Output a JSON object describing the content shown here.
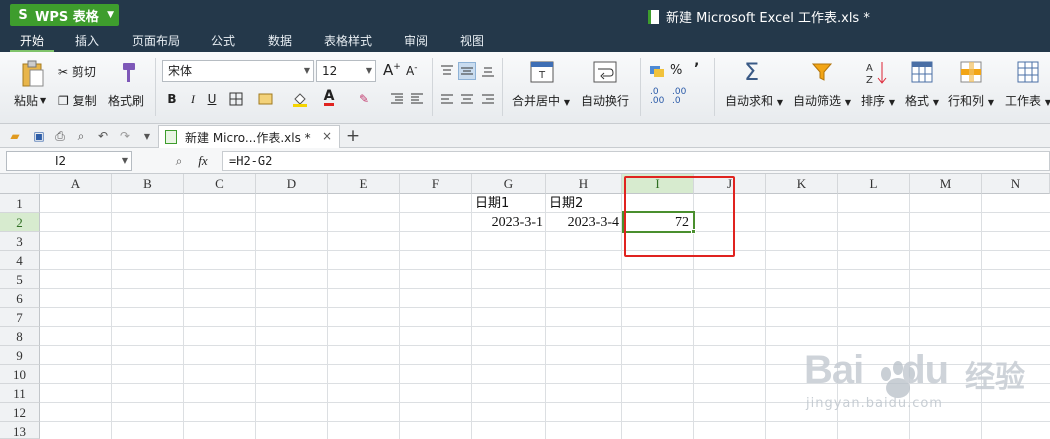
{
  "app": {
    "name": "WPS 表格",
    "logo_letter": "S",
    "window_title": "新建 Microsoft Excel 工作表.xls *"
  },
  "menu": {
    "tabs": [
      "开始",
      "插入",
      "页面布局",
      "公式",
      "数据",
      "表格样式",
      "审阅",
      "视图"
    ],
    "active": "开始"
  },
  "ribbon": {
    "paste": "粘贴",
    "cut": "剪切",
    "copy": "复制",
    "format_painter": "格式刷",
    "font_name": "宋体",
    "font_size": "12",
    "bold": "B",
    "italic": "I",
    "underline": "U",
    "increase_font": "A",
    "decrease_font": "A",
    "merge_center": "合并居中",
    "wrap_text": "自动换行",
    "percent": "%",
    "comma": "’",
    "autosum": "自动求和",
    "autofilter": "自动筛选",
    "sort": "排序",
    "format": "格式",
    "row_col": "行和列",
    "worksheet": "工作表",
    "inc_decimal": ".0\n.00",
    "dec_decimal": ".00\n.0"
  },
  "doc_tab": {
    "label": "新建 Micro...作表.xls *",
    "close": "×",
    "add": "+"
  },
  "formula_bar": {
    "name_box": "I2",
    "fx": "fx",
    "formula": "=H2-G2"
  },
  "sheet": {
    "columns": [
      "A",
      "B",
      "C",
      "D",
      "E",
      "F",
      "G",
      "H",
      "I",
      "J",
      "K",
      "L",
      "M",
      "N"
    ],
    "rows": [
      "1",
      "2",
      "3",
      "4",
      "5",
      "6",
      "7",
      "8",
      "9",
      "10",
      "11",
      "12",
      "13"
    ],
    "selected_column": "I",
    "selected_row": "2",
    "cells": {
      "G1": "日期1",
      "H1": "日期2",
      "G2": "2023-3-1",
      "H2": "2023-3-4",
      "I2": "72"
    }
  },
  "watermark": {
    "brand": "Bai",
    "brand2": "du",
    "cn": "经验",
    "url": "jingyan.baidu.com"
  },
  "colors": {
    "titlebar": "#24384a",
    "accent_green": "#3e9d2d",
    "annotation_red": "#e0231f"
  }
}
